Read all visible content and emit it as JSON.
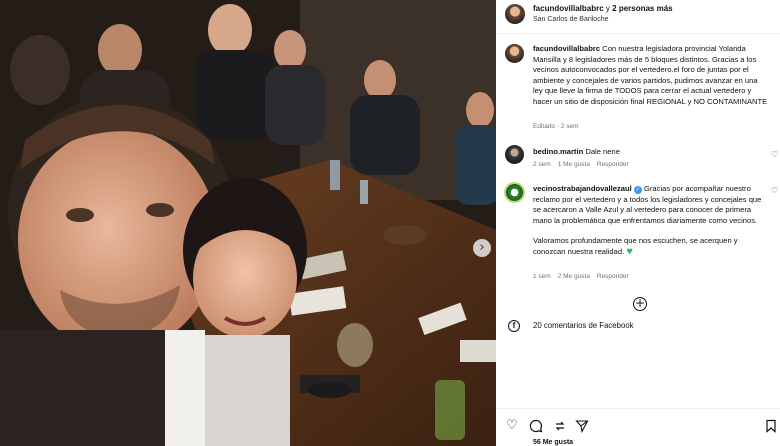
{
  "header": {
    "username": "facundovillalbabrc",
    "connector": " y ",
    "others": "2 personas más",
    "location": "San Carlos de Bariloche"
  },
  "caption": {
    "username": "facundovillalbabrc",
    "text": " Con nuestra legisladora provincial Yolanda Mansilla y 8 legisladores más de 5 bloques distintos. Gracias a los vecinos autoconvocados por el vertedero.el foro de juntas por el ambiente y concejales de varios partidos, pudimos avanzar en una ley que lleve la firma de TODOS para cerrar el actual vertedero y hacer un sitio de disposición final REGIONAL y NO CONTAMINANTE",
    "meta": "Editado · 2 sem"
  },
  "comments": [
    {
      "username": "bedino.martin",
      "text": " Dale nene",
      "time": "2 sem",
      "likes": "1 Me gusta",
      "reply": "Responder"
    },
    {
      "username": "vecinostrabajandovallezaul",
      "text_p1": " Gracias por acompañar nuestro reclamo por el vertedero y a todos los legisladores y concejales que se acercaron a Valle Azul y al vertedero para conocer de primera mano la problemática que enfrentamos diariamente como vecinos.",
      "text_p2": "Valoramos profundamente que nos escuchen, se acerquen y conozcan nuestra realidad. ",
      "time": "1 sem",
      "likes": "2 Me gusta",
      "reply": "Responder"
    }
  ],
  "more_comments_icon": "plus-circle-icon",
  "facebook": {
    "icon": "facebook-icon",
    "text": "20 comentarios de Facebook"
  },
  "actions": {
    "like_icon": "heart-icon",
    "comment_icon": "comment-icon",
    "share_icon": "share-icon",
    "send_icon": "paper-plane-icon",
    "save_icon": "bookmark-icon",
    "likes_peek": "56 Me gusta"
  },
  "colors": {
    "verified": "#3897f0",
    "meta_gray": "#737373",
    "green_heart": "#35b561"
  }
}
